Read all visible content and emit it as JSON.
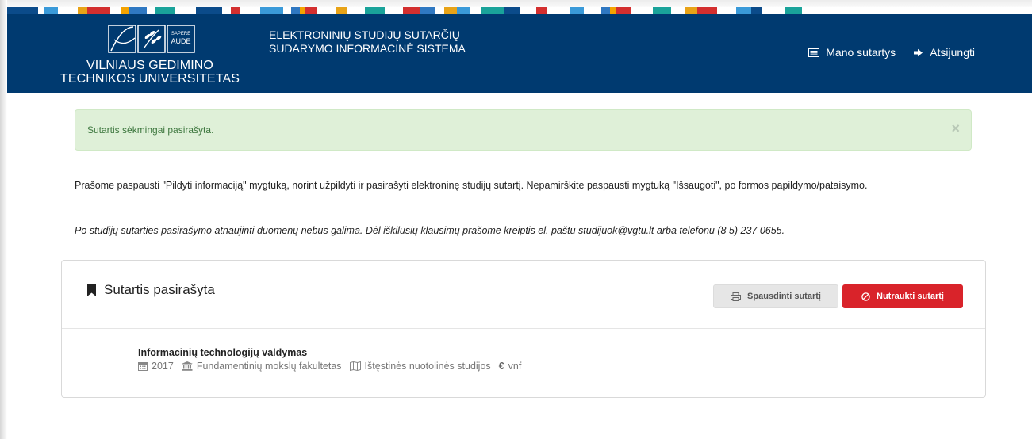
{
  "university": {
    "line1": "VILNIAUS GEDIMINO",
    "line2": "TECHNIKOS UNIVERSITETAS",
    "motto_top": "SAPERE",
    "motto_bottom": "AUDE"
  },
  "system": {
    "line1": "ELEKTRONINIŲ STUDIJŲ SUTARČIŲ",
    "line2": "SUDARYMO INFORMACINĖ SISTEMA"
  },
  "nav": {
    "my_contracts": "Mano sutartys",
    "logout": "Atsijungti"
  },
  "alert": {
    "text": "Sutartis sėkmingai pasirašyta.",
    "close": "×"
  },
  "info": {
    "paragraph1": "Prašome paspausti \"Pildyti informaciją\" mygtuką, norint užpildyti ir pasirašyti elektroninę studijų sutartį. Nepamirškite paspausti mygtuką \"Išsaugoti\", po formos papildymo/pataisymo.",
    "paragraph2": "Po studijų sutarties pasirašymo atnaujinti duomenų nebus galima. Dėl iškilusių klausimų prašome kreiptis el. paštu studijuok@vgtu.lt arba telefonu (8 5) 237 0655."
  },
  "panel": {
    "title": "Sutartis pasirašyta",
    "print_button": "Spausdinti sutartį",
    "cancel_button": "Nutraukti sutartį"
  },
  "study": {
    "name": "Informacinių technologijų valdymas",
    "year": "2017",
    "faculty": "Fundamentinių mokslų fakultetas",
    "mode": "Ištęstinės nuotolinės studijos",
    "funding": "vnf",
    "currency_symbol": "€"
  },
  "colors": {
    "navbar": "#003a70",
    "alert_bg": "#dff0d8",
    "alert_text": "#3c763d",
    "danger": "#d9232a"
  }
}
